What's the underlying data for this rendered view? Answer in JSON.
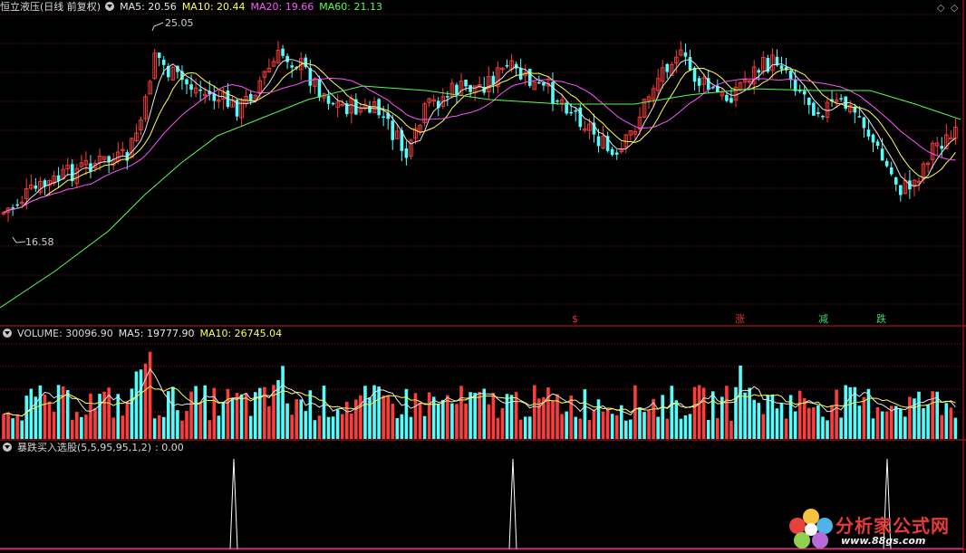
{
  "main_header": {
    "stock_title": "恒立液压(日线 前复权)",
    "ma5": "MA5: 20.56",
    "ma10": "MA10: 20.44",
    "ma20": "MA20: 19.66",
    "ma60": "MA60: 21.13"
  },
  "price_labels": {
    "high": "25.05",
    "low": "16.58"
  },
  "signals": [
    {
      "label": "$",
      "color": "#e8322d"
    },
    {
      "label": "涨",
      "color": "#e8322d"
    },
    {
      "label": "减",
      "color": "#3fd36d"
    },
    {
      "label": "跌",
      "color": "#3fd36d"
    }
  ],
  "volume_header": {
    "title": "VOLUME: 30096.90",
    "ma5": "MA5: 19777.90",
    "ma10": "MA10: 26745.04"
  },
  "indicator_header": {
    "title": "暴跌买入选股(5,5,95,95,1,2)",
    "value": ": 0.00"
  },
  "corner_icons": {
    "left": "◇",
    "right": "◇"
  },
  "logo": {
    "main_text": "分析家公式网",
    "sub_text": "www.88gs.com"
  },
  "colors": {
    "up": "#ff3c3c",
    "down": "#54fcfc",
    "ma5": "#e6e6e6",
    "ma10": "#ffff54",
    "ma20": "#ff54ff",
    "ma60": "#54ff54",
    "grid": "#8a1414",
    "axis": "#c81818"
  }
}
